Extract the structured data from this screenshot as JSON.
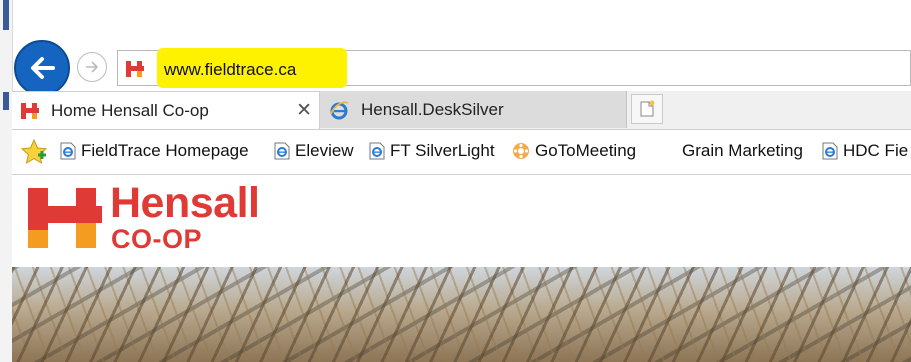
{
  "address_bar": {
    "url": "www.fieldtrace.ca"
  },
  "tabs": [
    {
      "label": "Home Hensall Co-op",
      "active": true,
      "close_glyph": "✕"
    },
    {
      "label": "Hensall.DeskSilver",
      "active": false
    }
  ],
  "favorites": [
    {
      "label": "FieldTrace Homepage",
      "icon": "ie-icon"
    },
    {
      "label": "Eleview",
      "icon": "ie-icon"
    },
    {
      "label": "FT SilverLight",
      "icon": "ie-icon"
    },
    {
      "label": "GoToMeeting",
      "icon": "gotomeeting-icon"
    },
    {
      "label": "Grain Marketing",
      "icon": "none"
    },
    {
      "label": "HDC Fie",
      "icon": "ie-icon"
    }
  ],
  "logo": {
    "line1": "Hensall",
    "line2": "CO-OP"
  },
  "colors": {
    "accent_blue": "#1565c0",
    "brand_red": "#e03a36",
    "brand_orange": "#f39c1f",
    "highlight": "#fff200"
  }
}
